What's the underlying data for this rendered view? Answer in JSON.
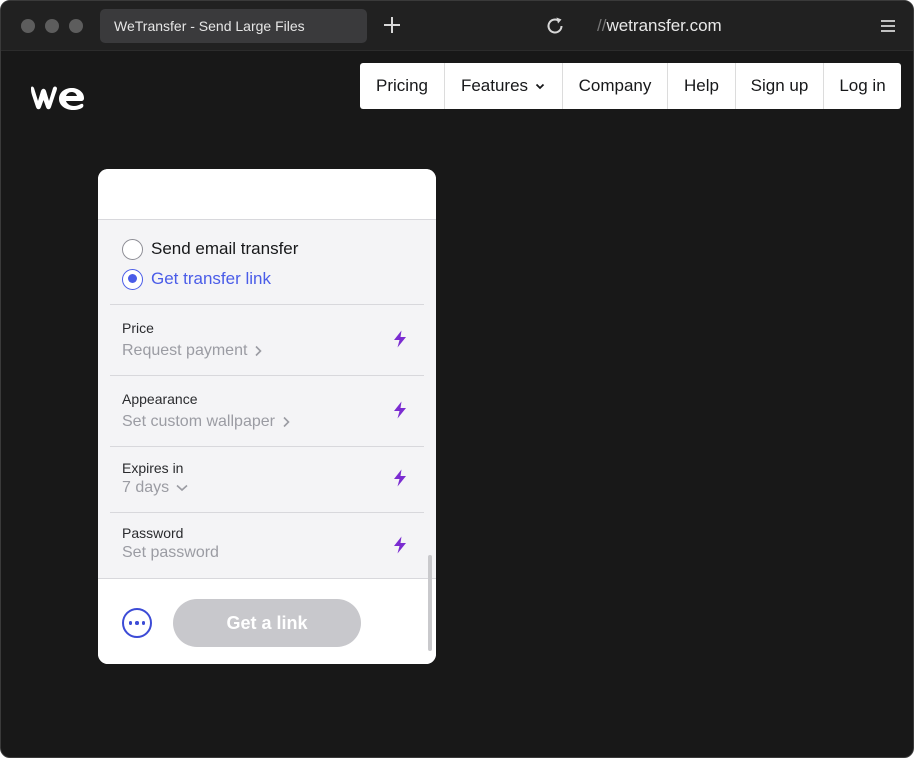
{
  "browser": {
    "tab_title": "WeTransfer - Send Large Files",
    "url_prefix": "//",
    "url": "wetransfer.com",
    "icons": [
      "close-dot",
      "minimize-dot",
      "zoom-dot",
      "plus-icon",
      "reload-icon",
      "hamburger-menu-icon"
    ]
  },
  "logo": {
    "alt": "we",
    "icon": "wetransfer-logo"
  },
  "nav": {
    "pricing": "Pricing",
    "features": "Features",
    "company": "Company",
    "help": "Help",
    "signup": "Sign up",
    "login": "Log in"
  },
  "panel": {
    "radio_email": "Send email transfer",
    "radio_link": "Get transfer link",
    "selected": "Get transfer link",
    "options": [
      {
        "title": "Price",
        "value": "Request payment",
        "arrow": "chevron-right"
      },
      {
        "title": "Appearance",
        "value": "Set custom wallpaper",
        "arrow": "chevron-right"
      },
      {
        "title": "Expires in",
        "value": "7 days",
        "arrow": "chevron-down"
      },
      {
        "title": "Password",
        "value": "Set password",
        "arrow": ""
      }
    ],
    "cta": "Get a link",
    "more_icon": "ellipsis-icon",
    "bolt_icon": "lightning-bolt-icon"
  },
  "colors": {
    "background": "#181818",
    "accent_blue": "#4a5ce8",
    "bolt_purple": "#7b2cd1",
    "cta_disabled": "#c8c8cc"
  }
}
